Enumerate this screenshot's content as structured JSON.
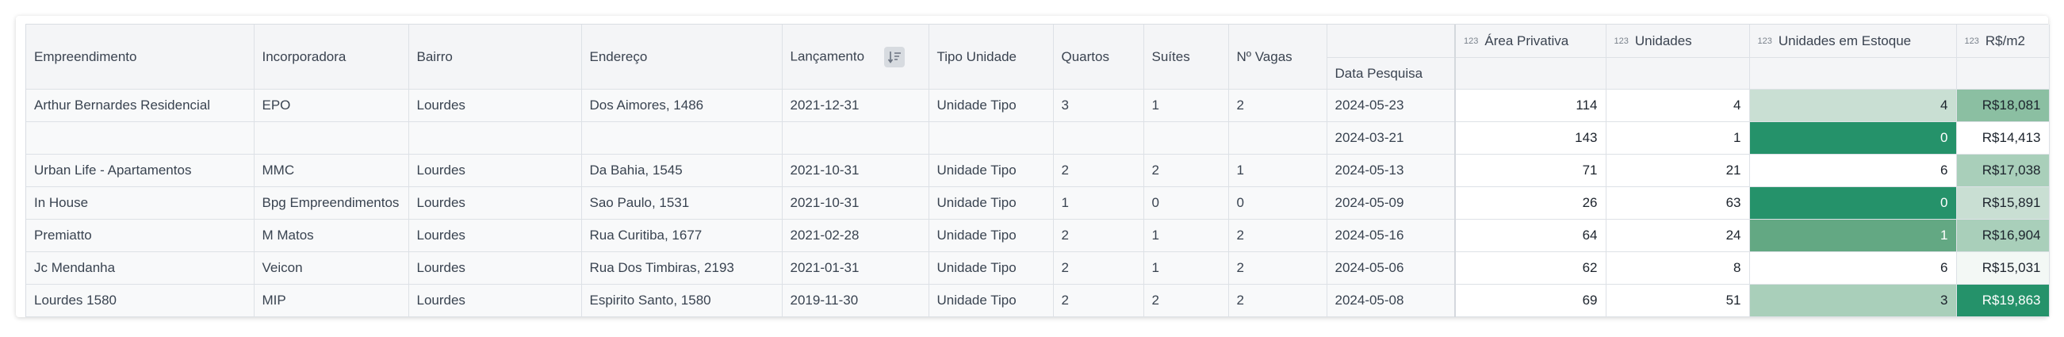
{
  "columns": {
    "empreendimento": "Empreendimento",
    "incorporadora": "Incorporadora",
    "bairro": "Bairro",
    "endereco": "Endereço",
    "lancamento": "Lançamento",
    "tipo_unidade": "Tipo Unidade",
    "quartos": "Quartos",
    "suites": "Suítes",
    "vagas": "Nº Vagas",
    "data_pesquisa": "Data Pesquisa",
    "area_privativa": "Área Privativa",
    "unidades": "Unidades",
    "unidades_estoque": "Unidades em Estoque",
    "rs_m2": "R$/m2",
    "numeric_tag": "123"
  },
  "icons": {
    "sort": "sort-descending-icon"
  },
  "heat_colors": {
    "c0": "#ffffff",
    "c1": "#c9dfd3",
    "c2": "#a9cfba",
    "c3": "#8bbfa2",
    "c4": "#63a883",
    "c5": "#25926a"
  },
  "rows": [
    {
      "empreendimento": "Arthur Bernardes Residencial",
      "incorporadora": "EPO",
      "bairro": "Lourdes",
      "endereco": "Dos Aimores, 1486",
      "lancamento": "2021-12-31",
      "tipo_unidade": "Unidade Tipo",
      "quartos": "3",
      "suites": "1",
      "vagas": "2",
      "data_pesquisa": "2024-05-23",
      "area_privativa": "114",
      "unidades": "4",
      "unidades_estoque": "4",
      "rs_m2": "R$18,081",
      "estoque_color": "#c9dfd3",
      "rsm2_color": "#8bbfa2",
      "estoque_text": "#1c232c",
      "rsm2_text": "#1c232c"
    },
    {
      "empreendimento": "",
      "incorporadora": "",
      "bairro": "",
      "endereco": "",
      "lancamento": "",
      "tipo_unidade": "",
      "quartos": "",
      "suites": "",
      "vagas": "",
      "data_pesquisa": "2024-03-21",
      "area_privativa": "143",
      "unidades": "1",
      "unidades_estoque": "0",
      "rs_m2": "R$14,413",
      "estoque_color": "#25926a",
      "rsm2_color": "#ffffff",
      "estoque_text": "#ffffff",
      "rsm2_text": "#1c232c"
    },
    {
      "empreendimento": "Urban Life - Apartamentos",
      "incorporadora": "MMC",
      "bairro": "Lourdes",
      "endereco": "Da Bahia, 1545",
      "lancamento": "2021-10-31",
      "tipo_unidade": "Unidade Tipo",
      "quartos": "2",
      "suites": "2",
      "vagas": "1",
      "data_pesquisa": "2024-05-13",
      "area_privativa": "71",
      "unidades": "21",
      "unidades_estoque": "6",
      "rs_m2": "R$17,038",
      "estoque_color": "#ffffff",
      "rsm2_color": "#a9cfba",
      "estoque_text": "#1c232c",
      "rsm2_text": "#1c232c"
    },
    {
      "empreendimento": "In House",
      "incorporadora": "Bpg Empreendimentos",
      "bairro": "Lourdes",
      "endereco": "Sao Paulo, 1531",
      "lancamento": "2021-10-31",
      "tipo_unidade": "Unidade Tipo",
      "quartos": "1",
      "suites": "0",
      "vagas": "0",
      "data_pesquisa": "2024-05-09",
      "area_privativa": "26",
      "unidades": "63",
      "unidades_estoque": "0",
      "rs_m2": "R$15,891",
      "estoque_color": "#25926a",
      "rsm2_color": "#c9dfd3",
      "estoque_text": "#ffffff",
      "rsm2_text": "#1c232c"
    },
    {
      "empreendimento": "Premiatto",
      "incorporadora": "M Matos",
      "bairro": "Lourdes",
      "endereco": "Rua Curitiba, 1677",
      "lancamento": "2021-02-28",
      "tipo_unidade": "Unidade Tipo",
      "quartos": "2",
      "suites": "1",
      "vagas": "2",
      "data_pesquisa": "2024-05-16",
      "area_privativa": "64",
      "unidades": "24",
      "unidades_estoque": "1",
      "rs_m2": "R$16,904",
      "estoque_color": "#63a883",
      "rsm2_color": "#a9cfba",
      "estoque_text": "#ffffff",
      "rsm2_text": "#1c232c"
    },
    {
      "empreendimento": "Jc Mendanha",
      "incorporadora": "Veicon",
      "bairro": "Lourdes",
      "endereco": "Rua Dos Timbiras, 2193",
      "lancamento": "2021-01-31",
      "tipo_unidade": "Unidade Tipo",
      "quartos": "2",
      "suites": "1",
      "vagas": "2",
      "data_pesquisa": "2024-05-06",
      "area_privativa": "62",
      "unidades": "8",
      "unidades_estoque": "6",
      "rs_m2": "R$15,031",
      "estoque_color": "#ffffff",
      "rsm2_color": "#f3f8f5",
      "estoque_text": "#1c232c",
      "rsm2_text": "#1c232c"
    },
    {
      "empreendimento": "Lourdes 1580",
      "incorporadora": "MIP",
      "bairro": "Lourdes",
      "endereco": "Espirito Santo, 1580",
      "lancamento": "2019-11-30",
      "tipo_unidade": "Unidade Tipo",
      "quartos": "2",
      "suites": "2",
      "vagas": "2",
      "data_pesquisa": "2024-05-08",
      "area_privativa": "69",
      "unidades": "51",
      "unidades_estoque": "3",
      "rs_m2": "R$19,863",
      "estoque_color": "#a9cfba",
      "rsm2_color": "#25926a",
      "estoque_text": "#1c232c",
      "rsm2_text": "#ffffff"
    }
  ]
}
